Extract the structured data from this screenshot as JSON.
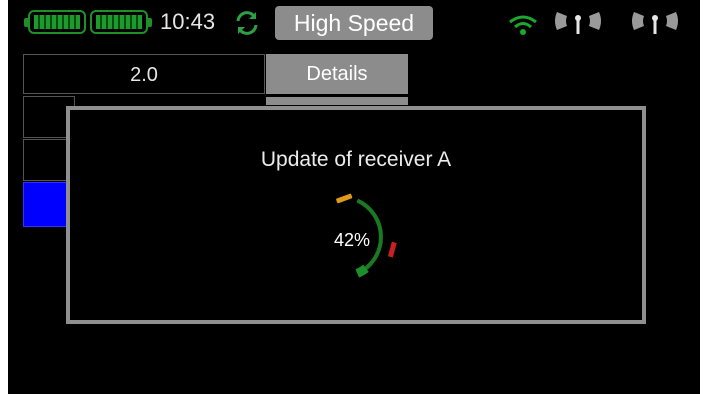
{
  "status_bar": {
    "time": "10:43",
    "mode": "High Speed",
    "icons": [
      "battery-icon",
      "battery-icon",
      "sync-icon",
      "wifi-icon",
      "antenna-icon",
      "antenna-icon"
    ],
    "colors": {
      "battery": "#1c9a2a",
      "sync": "#2ea043",
      "wifi": "#1aa82f",
      "badge": "#8c8c8c"
    }
  },
  "table": {
    "version": "2.0",
    "details_label": "Details"
  },
  "dialog": {
    "title": "Update of receiver  A",
    "progress_percent": 42,
    "progress_label": "42%"
  }
}
